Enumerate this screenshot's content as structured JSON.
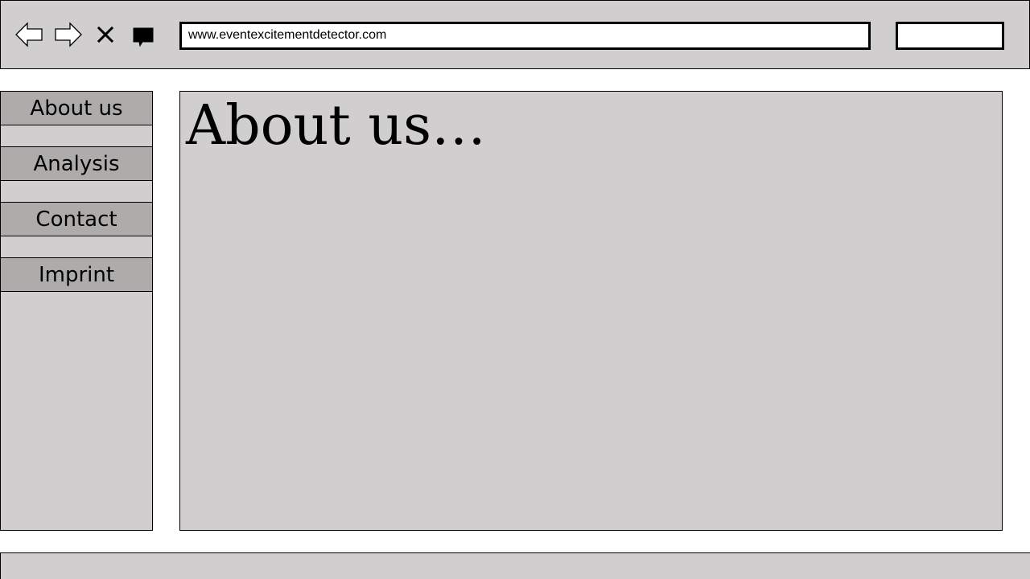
{
  "toolbar": {
    "back_icon": "back-arrow-icon",
    "forward_icon": "forward-arrow-icon",
    "stop_icon": "close-icon",
    "chat_icon": "speech-bubble-icon",
    "url": "www.eventexcitementdetector.com",
    "search_value": ""
  },
  "sidebar": {
    "items": [
      {
        "label": "About us"
      },
      {
        "label": "Analysis"
      },
      {
        "label": "Contact"
      },
      {
        "label": "Imprint"
      }
    ]
  },
  "main": {
    "title": "About us…"
  },
  "colors": {
    "panel_gray": "#d0cecf",
    "menu_gray": "#aeabab",
    "border": "#000000",
    "background": "#ffffff"
  }
}
